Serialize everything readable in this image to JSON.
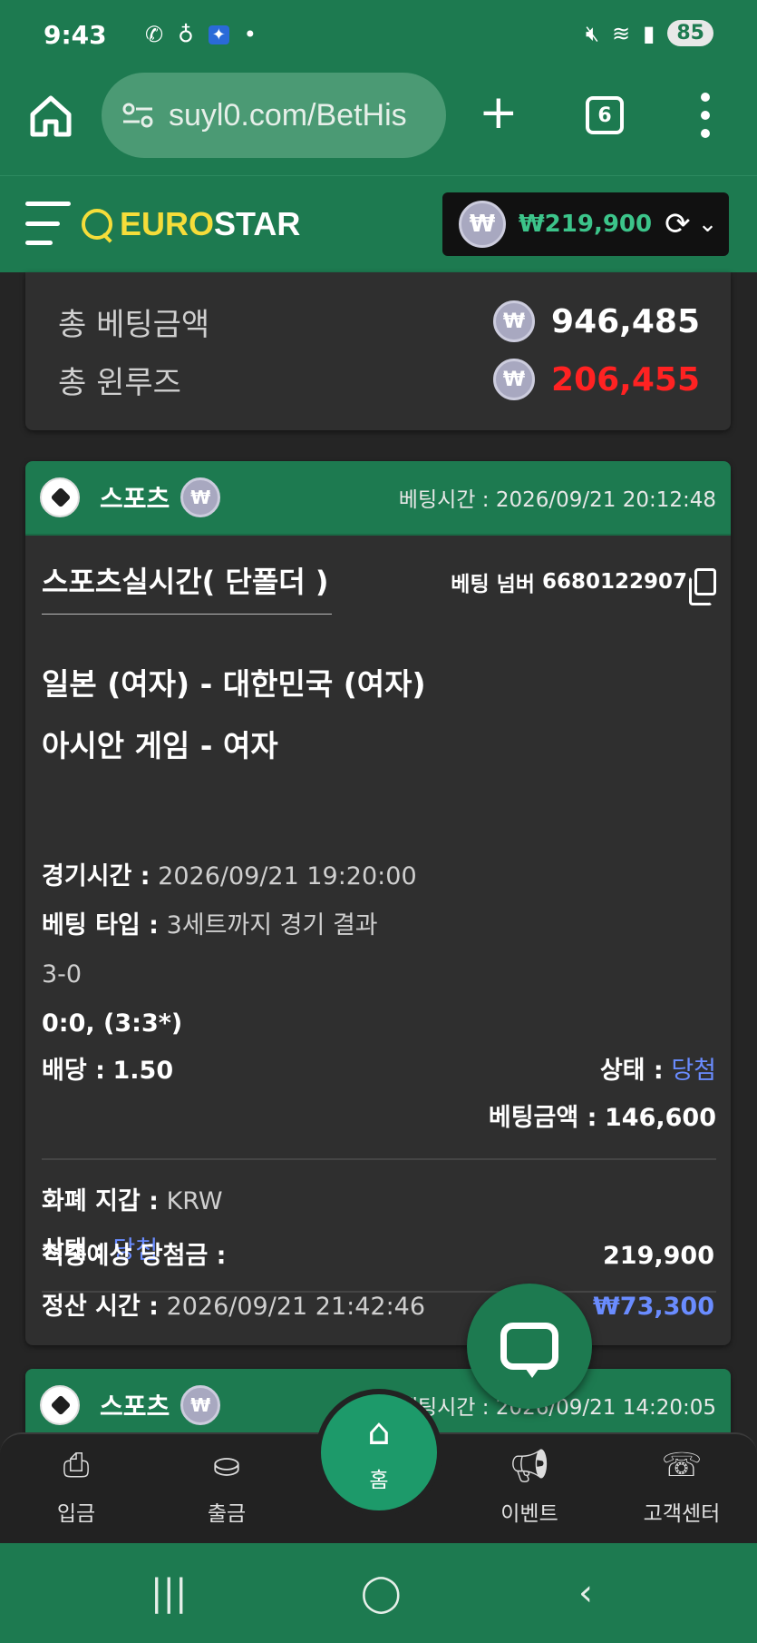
{
  "status_bar": {
    "time": "9:43",
    "battery": "85",
    "left_icons": [
      "vibrate-icon",
      "gallery-icon",
      "app-icon",
      "dot-icon"
    ],
    "right_icons": [
      "mute-icon",
      "wifi-icon",
      "signal-icon"
    ]
  },
  "browser": {
    "url": "suyl0.com/BetHis",
    "tab_count": "6"
  },
  "site": {
    "logo_euro": "EURO",
    "logo_star": "STAR",
    "balance": "₩219,900",
    "won_symbol": "₩"
  },
  "summary": {
    "total_bet_label": "총 베팅금액",
    "total_bet_value": "946,485",
    "total_winloss_label": "총 윈루즈",
    "total_winloss_value": "206,455"
  },
  "bets": [
    {
      "category": "스포츠",
      "bet_time_label": "베팅시간 :",
      "bet_time": "2026/09/21 20:12:48",
      "market": "스포츠실시간( 단폴더 )",
      "bet_number_label": "베팅 넘버",
      "bet_number": "6680122907",
      "match": "일본 (여자) - 대한민국 (여자)",
      "league": "아시안 게임 - 여자",
      "game_time_label": "경기시간 :",
      "game_time": "2026/09/21 19:20:00",
      "bet_type_label": "베팅 타입 :",
      "bet_type": "3세트까지 경기 결과",
      "selection": "3-0",
      "score": "0:0, (3:3*)",
      "odds_label": "배당 :",
      "odds": "1.50",
      "status_label": "상태 :",
      "status": "당첨",
      "bet_amount_label": "베팅금액 :",
      "bet_amount": "146,600",
      "currency_label": "화폐 지갑 :",
      "currency": "KRW",
      "status2_label": "상태 :",
      "status2": "당첨",
      "expected_win_label": "적중예상 당첨금 :",
      "expected_win": "219,900",
      "settle_time_label": "정산 시간 :",
      "settle_time": "2026/09/21 21:42:46",
      "profit": "₩73,300"
    },
    {
      "category": "스포츠",
      "bet_time_label": "베팅시간 :",
      "bet_time": "2026/09/21 14:20:05"
    }
  ],
  "bottom_nav": {
    "deposit": "입금",
    "withdraw": "출금",
    "home": "홈",
    "event": "이벤트",
    "support": "고객센터"
  },
  "colors": {
    "brand_green": "#1d7a50",
    "accent_yellow": "#f5dd3a",
    "balance_green": "#3cc48a",
    "loss_red": "#ff2222",
    "win_blue": "#6a8cff"
  }
}
